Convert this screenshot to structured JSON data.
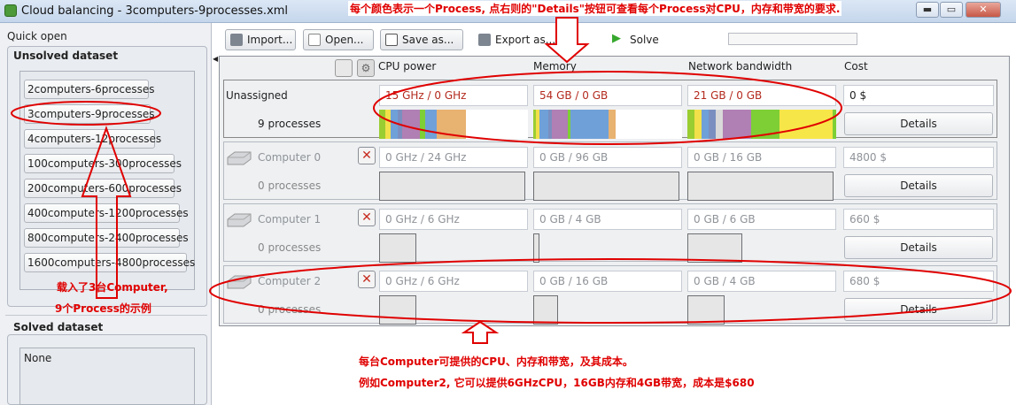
{
  "window": {
    "title": "Cloud balancing - 3computers-9processes.xml",
    "min": "▬",
    "max": "▭",
    "close": "✕"
  },
  "left": {
    "quick_open": "Quick open",
    "unsolved_title": "Unsolved dataset",
    "unsolved": [
      "2computers-6processes",
      "3computers-9processes",
      "4computers-12processes",
      "100computers-300processes",
      "200computers-600processes",
      "400computers-1200processes",
      "800computers-2400processes",
      "1600computers-4800processes"
    ],
    "solved_title": "Solved dataset",
    "solved": [
      "None"
    ]
  },
  "toolbar": {
    "import": "Import...",
    "open": "Open...",
    "save": "Save as...",
    "export": "Export as...",
    "solve": "Solve"
  },
  "columns": {
    "cpu": "CPU power",
    "memory": "Memory",
    "network": "Network bandwidth",
    "cost": "Cost"
  },
  "unassigned": {
    "name": "Unassigned",
    "count": "9 processes",
    "cpu": "15 GHz / 0 GHz",
    "memory": "54 GB / 0 GB",
    "network": "21 GB / 0 GB",
    "cost": "0 $",
    "details": "Details"
  },
  "computers": [
    {
      "name": "Computer 0",
      "count": "0 processes",
      "cpu": "0 GHz / 24 GHz",
      "memory": "0 GB / 96 GB",
      "network": "0 GB / 16 GB",
      "cost": "4800 $",
      "details": "Details"
    },
    {
      "name": "Computer 1",
      "count": "0 processes",
      "cpu": "0 GHz / 6 GHz",
      "memory": "0 GB / 4 GB",
      "network": "0 GB / 6 GB",
      "cost": "660 $",
      "details": "Details"
    },
    {
      "name": "Computer 2",
      "count": "0 processes",
      "cpu": "0 GHz / 6 GHz",
      "memory": "0 GB / 16 GB",
      "network": "0 GB / 4 GB",
      "cost": "680 $",
      "details": "Details"
    }
  ],
  "process_colors": [
    "#9acd32",
    "#f2e04a",
    "#6fa0d8",
    "#b07fb3",
    "#e8b270",
    "#7a8fc0",
    "#d9d9d9",
    "#7dcf35",
    "#f7e648"
  ],
  "annotations": {
    "top": "每个颜色表示一个Process, 点右则的\"Details\"按钮可查看每个Process对CPU，内存和带宽的要求.",
    "left1": "载入了3台Computer,",
    "left2": "9个Process的示例",
    "bottom1": "每台Computer可提供的CPU、内存和带宽，及其成本。",
    "bottom2": "例如Computer2, 它可以提供6GHzCPU，16GB内存和4GB带宽，成本是$680"
  }
}
